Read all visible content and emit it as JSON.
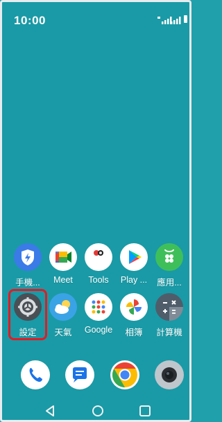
{
  "status_bar": {
    "time": "10:00"
  },
  "apps_row1": [
    {
      "label": "手機..."
    },
    {
      "label": "Meet"
    },
    {
      "label": "Tools"
    },
    {
      "label": "Play ..."
    },
    {
      "label": "應用..."
    }
  ],
  "apps_row2": [
    {
      "label": "設定"
    },
    {
      "label": "天氣"
    },
    {
      "label": "Google"
    },
    {
      "label": "相簿"
    },
    {
      "label": "計算機"
    }
  ],
  "dock": [
    "phone",
    "messages",
    "chrome",
    "camera"
  ],
  "colors": {
    "wallpaper": "#1a9aa6",
    "highlight": "#e21b24"
  }
}
